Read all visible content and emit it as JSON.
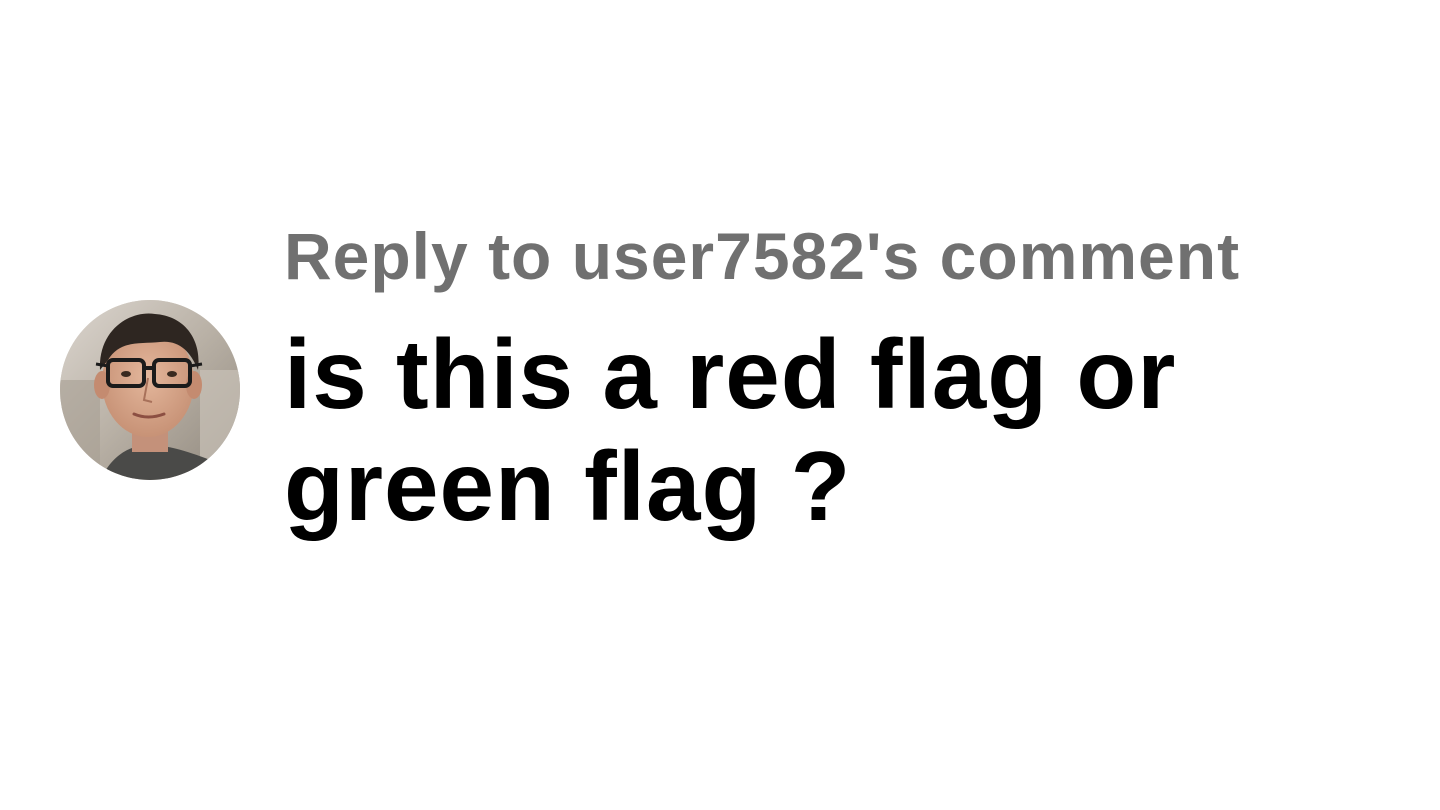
{
  "reply": {
    "label": "Reply to user7582's comment"
  },
  "comment": {
    "text": "is this a red flag or green flag ?"
  },
  "avatar": {
    "icon": "user-avatar-photo"
  },
  "colors": {
    "background": "#ffffff",
    "label": "#707070",
    "text": "#000000"
  }
}
